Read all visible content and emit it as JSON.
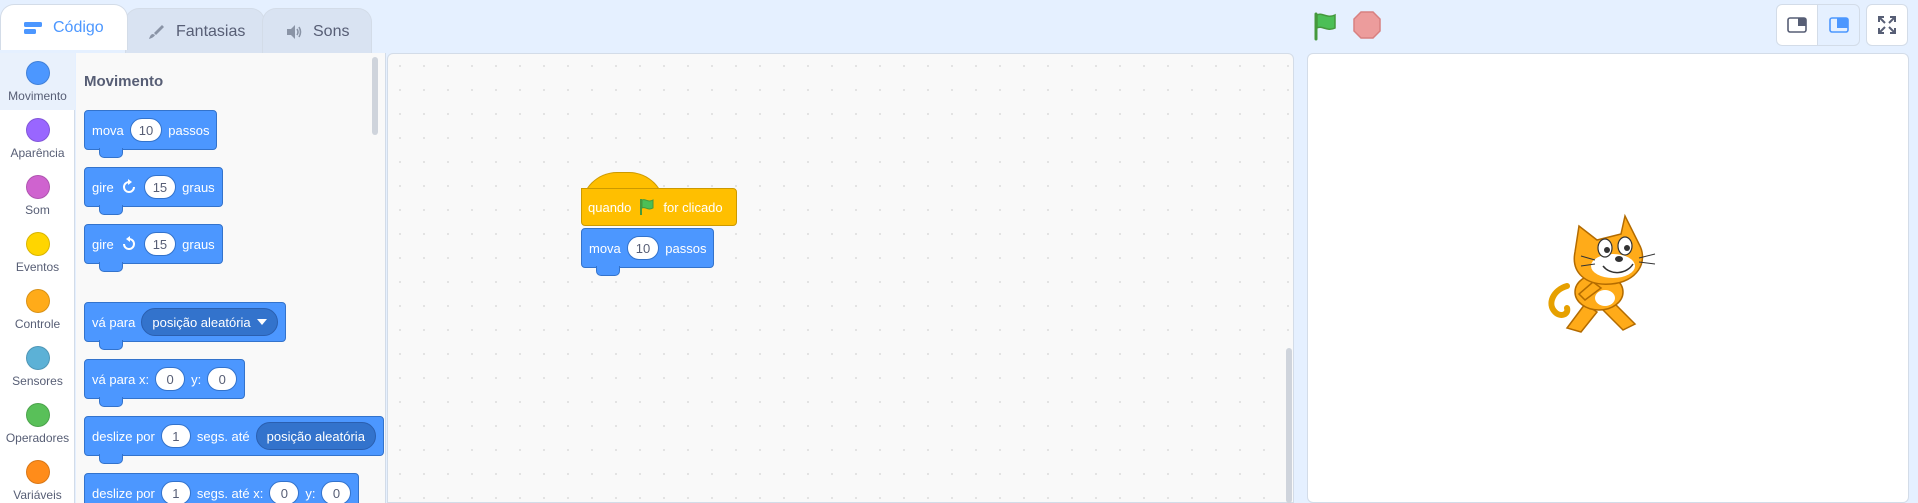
{
  "tabs": [
    {
      "label": "Código",
      "icon": "code-icon"
    },
    {
      "label": "Fantasias",
      "icon": "brush-icon"
    },
    {
      "label": "Sons",
      "icon": "speaker-icon"
    }
  ],
  "categories": [
    {
      "label": "Movimento",
      "color": "#4c97ff"
    },
    {
      "label": "Aparência",
      "color": "#9966ff"
    },
    {
      "label": "Som",
      "color": "#cf63cf"
    },
    {
      "label": "Eventos",
      "color": "#ffd500"
    },
    {
      "label": "Controle",
      "color": "#ffab19"
    },
    {
      "label": "Sensores",
      "color": "#5cb1d6"
    },
    {
      "label": "Operadores",
      "color": "#59c059"
    },
    {
      "label": "Variáveis",
      "color": "#ff8c1a"
    }
  ],
  "palette": {
    "title": "Movimento",
    "move": {
      "label": "mova",
      "value": "10",
      "suffix": "passos"
    },
    "turn_right": {
      "label": "gire",
      "value": "15",
      "suffix": "graus"
    },
    "turn_left": {
      "label": "gire",
      "value": "15",
      "suffix": "graus"
    },
    "goto": {
      "label": "vá para",
      "option": "posição aleatória"
    },
    "goto_xy": {
      "label": "vá para x:",
      "x": "0",
      "ylabel": "y:",
      "y": "0"
    },
    "glide_to": {
      "label": "deslize por",
      "secs": "1",
      "mid": "segs. até",
      "option": "posição aleatória"
    },
    "glide_xy": {
      "label": "deslize por",
      "secs": "1",
      "mid": "segs. até x:",
      "x": "0",
      "ylabel": "y:",
      "y": "0"
    }
  },
  "script": {
    "hat_prefix": "quando",
    "hat_suffix": "for clicado",
    "move_label": "mova",
    "move_value": "10",
    "move_suffix": "passos"
  },
  "colors": {
    "motion": "#4c97ff",
    "events": "#ffbf00",
    "accent": "#4c97ff"
  }
}
